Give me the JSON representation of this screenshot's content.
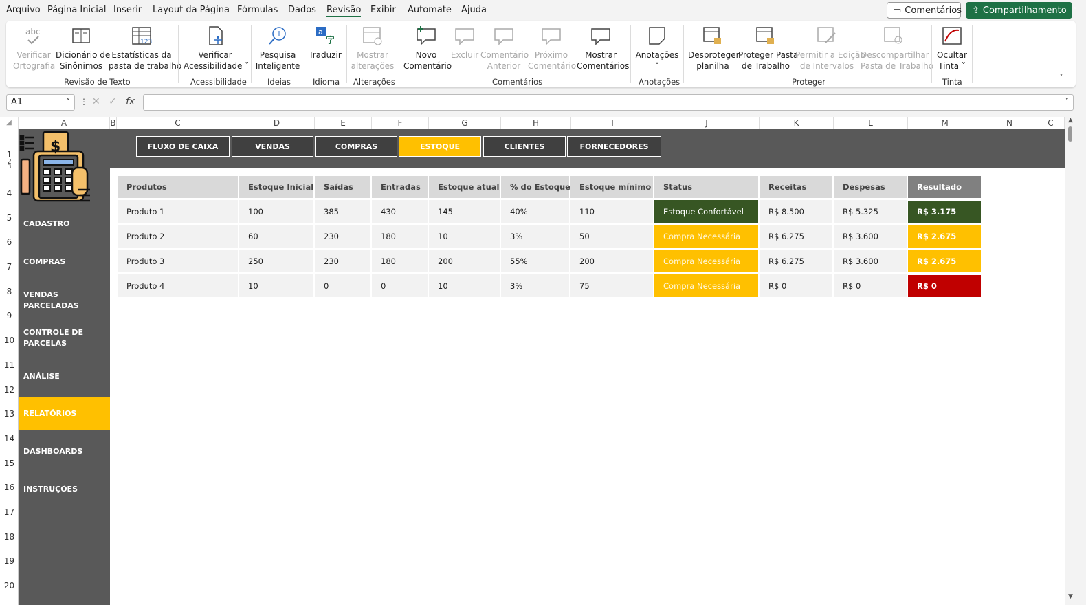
{
  "menu": {
    "items": [
      "Arquivo",
      "Página Inicial",
      "Inserir",
      "Layout da Página",
      "Fórmulas",
      "Dados",
      "Revisão",
      "Exibir",
      "Automate",
      "Ajuda"
    ],
    "active": "Revisão",
    "comments_btn": "Comentários",
    "share_btn": "Compartilhamento"
  },
  "ribbon": {
    "buttons": [
      {
        "l1": "Verificar",
        "l2": "Ortografia",
        "icon": "spellcheck-icon"
      },
      {
        "l1": "Dicionário de",
        "l2": "Sinônimos",
        "icon": "thesaurus-icon"
      },
      {
        "l1": "Estatísticas da",
        "l2": "pasta de trabalho",
        "icon": "workbook-stats-icon"
      },
      {
        "l1": "Verificar",
        "l2": "Acessibilidade ˅",
        "icon": "accessibility-icon"
      },
      {
        "l1": "Pesquisa",
        "l2": "Inteligente",
        "icon": "smart-lookup-icon"
      },
      {
        "l1": "Traduzir",
        "l2": "",
        "icon": "translate-icon"
      },
      {
        "l1": "Mostrar",
        "l2": "alterações",
        "icon": "show-changes-icon"
      },
      {
        "l1": "Novo",
        "l2": "Comentário",
        "icon": "new-comment-icon"
      },
      {
        "l1": "Excluir",
        "l2": "",
        "icon": "delete-comment-icon"
      },
      {
        "l1": "Comentário",
        "l2": "Anterior",
        "icon": "previous-comment-icon"
      },
      {
        "l1": "Próximo",
        "l2": "Comentário",
        "icon": "next-comment-icon"
      },
      {
        "l1": "Mostrar",
        "l2": "Comentários",
        "icon": "show-comments-icon"
      },
      {
        "l1": "Anotações",
        "l2": "˅",
        "icon": "notes-icon"
      },
      {
        "l1": "Desproteger",
        "l2": "planilha",
        "icon": "unprotect-sheet-icon"
      },
      {
        "l1": "Proteger Pasta",
        "l2": "de Trabalho",
        "icon": "protect-workbook-icon"
      },
      {
        "l1": "Permitir a Edição",
        "l2": "de Intervalos",
        "icon": "allow-edit-ranges-icon"
      },
      {
        "l1": "Descompartilhar",
        "l2": "Pasta de Trabalho",
        "icon": "unshare-workbook-icon"
      },
      {
        "l1": "Ocultar",
        "l2": "Tinta ˅",
        "icon": "hide-ink-icon"
      }
    ],
    "groups": [
      "Revisão de Texto",
      "Acessibilidade",
      "Ideias",
      "Idioma",
      "Alterações",
      "Comentários",
      "Anotações",
      "Proteger",
      "Tinta"
    ]
  },
  "formula": {
    "namebox": "A1",
    "fx": "fx"
  },
  "columns": [
    "A",
    "B",
    "C",
    "D",
    "E",
    "F",
    "G",
    "H",
    "I",
    "J",
    "K",
    "L",
    "M",
    "N",
    "C"
  ],
  "rows": [
    "1",
    "2",
    "3",
    "4",
    "5",
    "6",
    "7",
    "8",
    "9",
    "10",
    "11",
    "12",
    "13",
    "14",
    "15",
    "16",
    "17",
    "18",
    "19",
    "20"
  ],
  "nav_tabs": [
    "FLUXO DE CAIXA",
    "VENDAS",
    "COMPRAS",
    "ESTOQUE",
    "CLIENTES",
    "FORNECEDORES"
  ],
  "active_tab": "ESTOQUE",
  "sidebar": [
    "CADASTRO",
    "COMPRAS",
    "VENDAS PARCELADAS",
    "CONTROLE DE PARCELAS",
    "ANÁLISE",
    "RELATÓRIOS",
    "DASHBOARDS",
    "INSTRUÇÕES"
  ],
  "active_side": "RELATÓRIOS",
  "table": {
    "headers": [
      "Produtos",
      "Estoque Inicial",
      "Saídas",
      "Entradas",
      "Estoque atual",
      "% do Estoque",
      "Estoque mínimo",
      "Status",
      "Receitas",
      "Despesas",
      "Resultado"
    ],
    "rows": [
      [
        "Produto 1",
        "100",
        "385",
        "430",
        "145",
        "40%",
        "110",
        "Estoque Confortável",
        "R$ 8.500",
        "R$ 5.325",
        "R$ 3.175"
      ],
      [
        "Produto 2",
        "60",
        "230",
        "180",
        "10",
        "3%",
        "50",
        "Compra Necessária",
        "R$ 6.275",
        "R$ 3.600",
        "R$ 2.675"
      ],
      [
        "Produto 3",
        "250",
        "230",
        "180",
        "200",
        "55%",
        "200",
        "Compra Necessária",
        "R$ 6.275",
        "R$ 3.600",
        "R$ 2.675"
      ],
      [
        "Produto 4",
        "10",
        "0",
        "0",
        "10",
        "3%",
        "75",
        "Compra Necessária",
        "R$ 0",
        "R$ 0",
        "R$ 0"
      ]
    ],
    "status_colors": [
      "#375623",
      "#ffc000",
      "#ffc000",
      "#ffc000"
    ],
    "result_colors": [
      "#375623",
      "#ffc000",
      "#ffc000",
      "#c00000"
    ]
  },
  "colors": {
    "accent": "#1e7145",
    "panel": "#595959",
    "highlight": "#ffc000"
  }
}
